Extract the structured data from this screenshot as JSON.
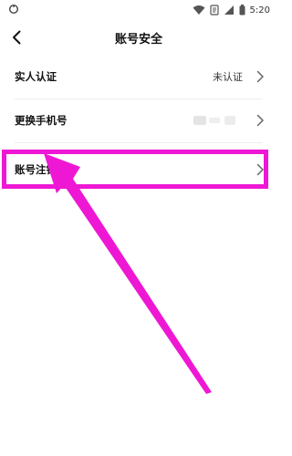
{
  "status_bar": {
    "time": "5:20",
    "icons": [
      "app-status-icon",
      "wifi-icon",
      "notification-icon",
      "cellular-signal-icon",
      "battery-icon"
    ]
  },
  "header": {
    "back_icon": "chevron-left-icon",
    "title": "账号安全"
  },
  "settings_rows": [
    {
      "label": "实人认证",
      "value": "未认证",
      "chevron_icon": "chevron-right-icon"
    },
    {
      "label": "更换手机号",
      "value": "",
      "chevron_icon": "chevron-right-icon"
    },
    {
      "label": "账号注销",
      "value": "",
      "chevron_icon": "chevron-right-icon"
    }
  ],
  "annotation": {
    "color": "#ee18d4",
    "highlighted_row": "账号注销"
  }
}
